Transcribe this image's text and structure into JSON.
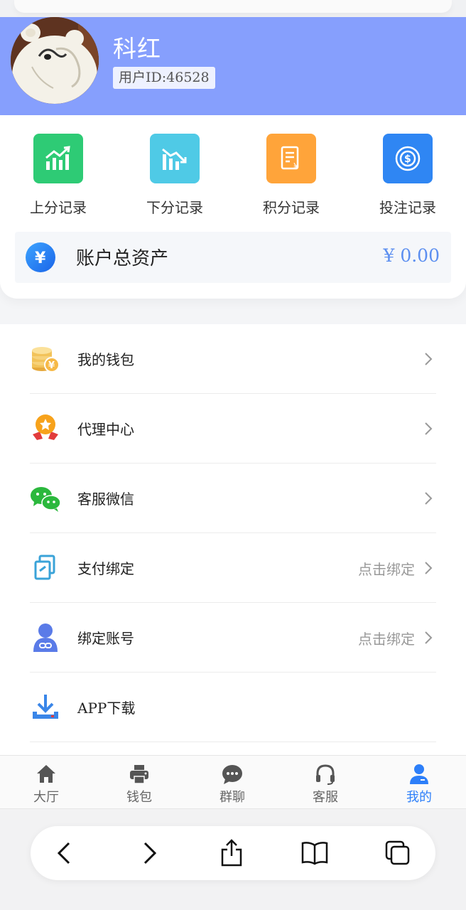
{
  "profile": {
    "name": "科红",
    "user_id": "用户ID:46528"
  },
  "quick_actions": [
    {
      "label": "上分记录",
      "icon": "chart-up-icon",
      "color": "#2ecb75"
    },
    {
      "label": "下分记录",
      "icon": "chart-down-icon",
      "color": "#4fcae6"
    },
    {
      "label": "积分记录",
      "icon": "document-yen-icon",
      "color": "#ffa43a"
    },
    {
      "label": "投注记录",
      "icon": "coin-dollar-icon",
      "color": "#2f86f3"
    }
  ],
  "assets": {
    "label": "账户总资产",
    "value": "¥ 0.00",
    "icon": "yen-circle-icon"
  },
  "menu": [
    {
      "label": "我的钱包",
      "icon": "coins-icon",
      "status": ""
    },
    {
      "label": "代理中心",
      "icon": "medal-icon",
      "status": ""
    },
    {
      "label": "客服微信",
      "icon": "wechat-icon",
      "status": ""
    },
    {
      "label": "支付绑定",
      "icon": "copy-link-icon",
      "status": "点击绑定"
    },
    {
      "label": "绑定账号",
      "icon": "user-link-icon",
      "status": "点击绑定"
    },
    {
      "label": "APP下载",
      "icon": "download-icon",
      "status": ""
    }
  ],
  "tabs": [
    {
      "label": "大厅",
      "icon": "home-icon",
      "active": false
    },
    {
      "label": "钱包",
      "icon": "printer-icon",
      "active": false
    },
    {
      "label": "群聊",
      "icon": "chat-bubble-icon",
      "active": false
    },
    {
      "label": "客服",
      "icon": "headset-icon",
      "active": false
    },
    {
      "label": "我的",
      "icon": "user-icon",
      "active": true
    }
  ],
  "colors": {
    "header_bg": "#869ffd",
    "accent_blue": "#2d7ff9",
    "asset_value": "#5c8ff0"
  }
}
